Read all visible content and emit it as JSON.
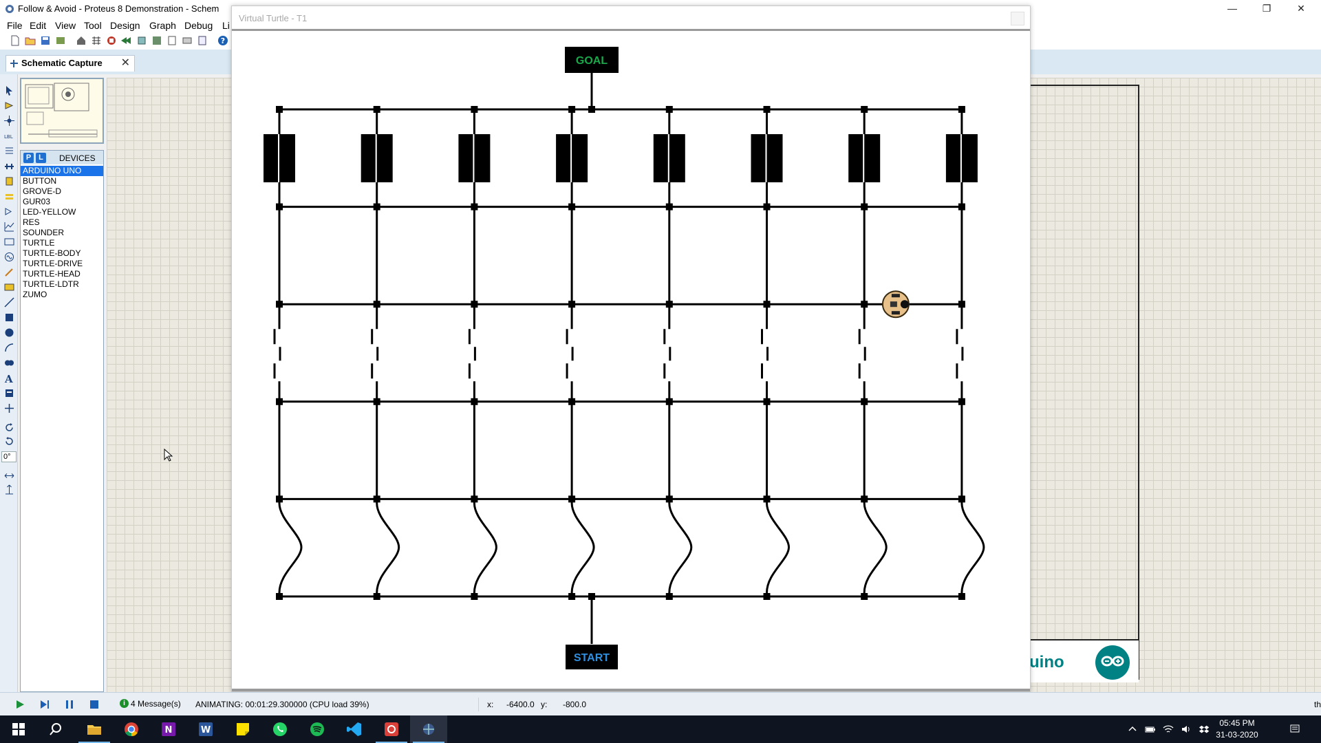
{
  "app": {
    "title": "Follow & Avoid - Proteus 8 Demonstration - Schem",
    "window_controls": [
      "minimize",
      "restore",
      "close"
    ]
  },
  "menu": [
    "File",
    "Edit",
    "View",
    "Tool",
    "Design",
    "Graph",
    "Debug",
    "Li"
  ],
  "tab": {
    "label": "Schematic Capture",
    "close_glyph": "✕"
  },
  "devices_panel": {
    "p_button": "P",
    "l_button": "L",
    "title": "DEVICES",
    "items": [
      "ARDUINO UNO",
      "BUTTON",
      "GROVE-D",
      "GUR03",
      "LED-YELLOW",
      "RES",
      "SOUNDER",
      "TURTLE",
      "TURTLE-BODY",
      "TURTLE-DRIVE",
      "TURTLE-HEAD",
      "TURTLE-LDTR",
      "ZUMO"
    ],
    "selected": "ARDUINO UNO"
  },
  "rotation_field": {
    "value": "0°"
  },
  "canvas": {
    "arduino_label": "uino"
  },
  "virtual_turtle": {
    "title": "Virtual Turtle - T1",
    "goal_label": "GOAL",
    "start_label": "START",
    "goal_color": "#1aa84a",
    "start_color": "#2f8fe0",
    "grid_columns": 8,
    "grid_rows": 6,
    "turtle_position": {
      "column": 7,
      "row": 3
    }
  },
  "status": {
    "message_count": "4 Message(s)",
    "message_icon": "i",
    "animation": "ANIMATING: 00:01:29.300000 (CPU load 39%)",
    "x_label": "x:",
    "x_value": "-6400.0",
    "y_label": "y:",
    "y_value": "-800.0",
    "right_text": "th"
  },
  "taskbar": {
    "apps": [
      "start",
      "search",
      "file-explorer",
      "chrome",
      "onenote",
      "word",
      "sticky-notes",
      "whatsapp",
      "spotify",
      "vscode",
      "proteus-red",
      "proteus"
    ],
    "time": "05:45 PM",
    "date": "31-03-2020"
  },
  "colors": {
    "accent": "#1a73e8",
    "tab_strip": "#d9e8f3",
    "taskbar": "#0f1520",
    "canvas_bg": "#eceae0"
  }
}
